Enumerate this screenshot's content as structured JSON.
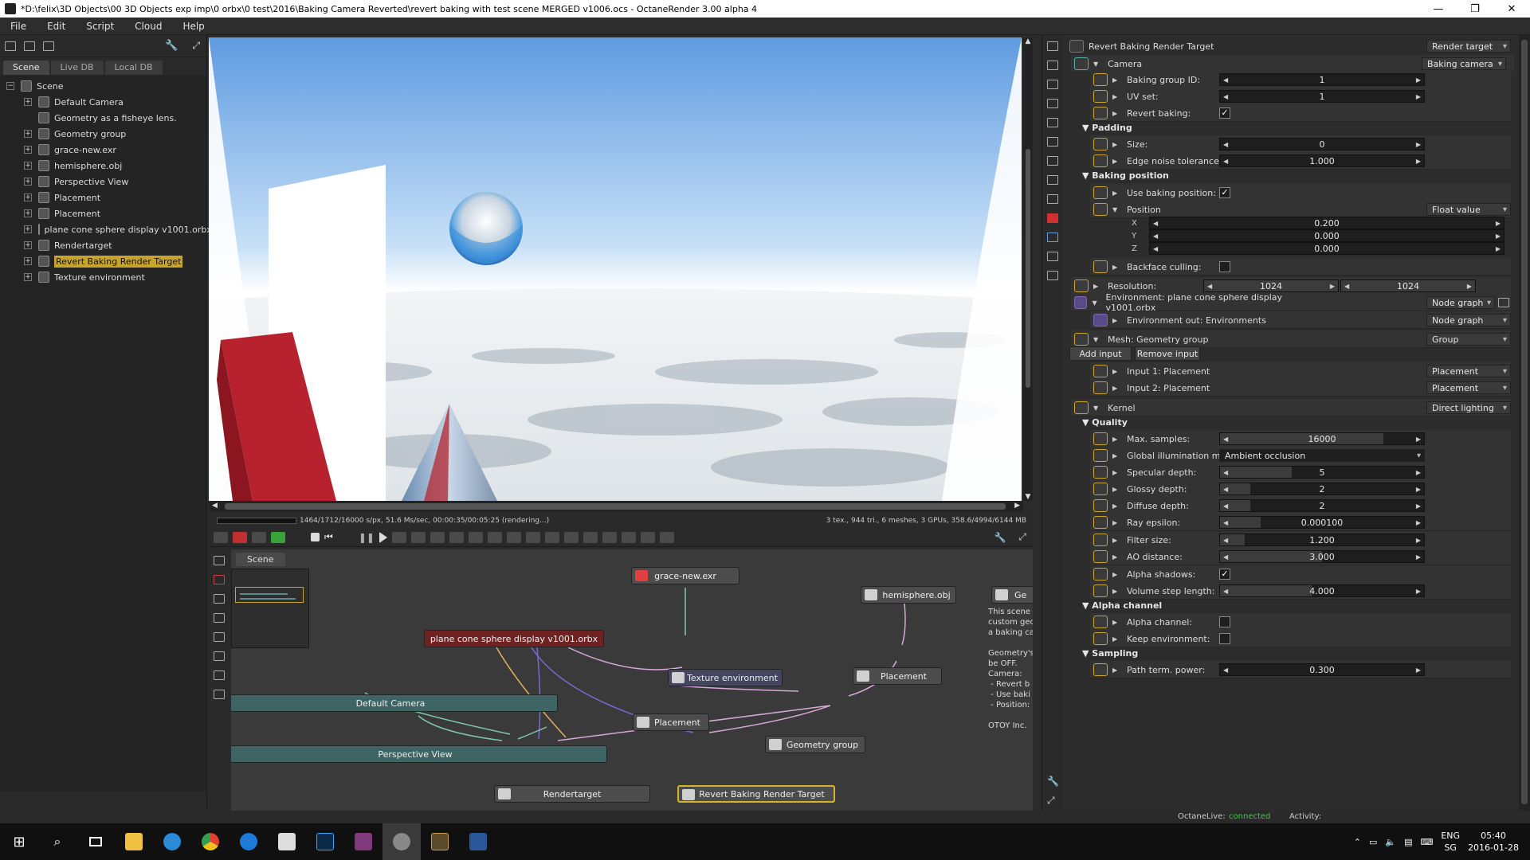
{
  "window": {
    "title": "*D:\\felix\\3D Objects\\00 3D Objects exp imp\\0 orbx\\0 test\\2016\\Baking Camera Reverted\\revert baking with test scene MERGED v1006.ocs - OctaneRender 3.00 alpha 4"
  },
  "menu": [
    "File",
    "Edit",
    "Script",
    "Cloud",
    "Help"
  ],
  "left": {
    "tabs": [
      "Scene",
      "Live DB",
      "Local DB"
    ],
    "root": "Scene",
    "items": [
      {
        "label": "Default Camera",
        "icon": "camera-icon"
      },
      {
        "label": "Geometry as a fisheye lens.",
        "icon": "comment-icon"
      },
      {
        "label": "Geometry group",
        "icon": "geometry-group-icon"
      },
      {
        "label": "grace-new.exr",
        "icon": "image-texture-icon"
      },
      {
        "label": "hemisphere.obj",
        "icon": "mesh-icon"
      },
      {
        "label": "Perspective View",
        "icon": "camera-icon"
      },
      {
        "label": "Placement",
        "icon": "placement-icon"
      },
      {
        "label": "Placement",
        "icon": "placement-icon"
      },
      {
        "label": "plane cone sphere display v1001.orbx",
        "icon": "orbx-icon"
      },
      {
        "label": "Rendertarget",
        "icon": "rendertarget-icon"
      },
      {
        "label": "Revert Baking Render Target",
        "icon": "rendertarget-icon",
        "selected": true
      },
      {
        "label": "Texture environment",
        "icon": "environment-icon"
      }
    ]
  },
  "render": {
    "status": "1464/1712/16000 s/px, 51.6 Ms/sec, 00:00:35/00:05:25 (rendering...)",
    "stats": "3 tex., 944 tri., 6 meshes, 3 GPUs, 358.6/4994/6144 MB"
  },
  "nodegraph": {
    "tab": "Scene",
    "nodes": {
      "grace": "grace-new.exr",
      "hemisphere": "hemisphere.obj",
      "orbx": "plane cone sphere display v1001.orbx",
      "texenv": "Texture environment",
      "default_camera": "Default Camera",
      "placement1": "Placement",
      "placement2": "Placement",
      "geometry_group": "Geometry group",
      "perspective_view": "Perspective View",
      "rendertarget": "Rendertarget",
      "revert_rt": "Revert Baking Render Target",
      "comment_title": "Ge"
    },
    "comment": [
      "This scene",
      "custom geo",
      "a baking ca",
      "",
      "Geometry's",
      "be OFF.",
      "Camera:",
      " - Revert b",
      " - Use baki",
      " - Position:",
      "",
      "OTOY Inc."
    ]
  },
  "props": {
    "header": "Revert Baking Render Target",
    "header_type": "Render target",
    "camera": {
      "label": "Camera",
      "type": "Baking camera"
    },
    "baking_group_id": {
      "label": "Baking group ID:",
      "value": "1"
    },
    "uv_set": {
      "label": "UV set:",
      "value": "1"
    },
    "revert_baking": {
      "label": "Revert baking:",
      "checked": "✓"
    },
    "padding_section": "Padding",
    "size": {
      "label": "Size:",
      "value": "0"
    },
    "edge_noise": {
      "label": "Edge noise tolerance:",
      "value": "1.000"
    },
    "baking_position_section": "Baking position",
    "use_baking_position": {
      "label": "Use baking position:",
      "checked": "✓"
    },
    "position": {
      "label": "Position",
      "type": "Float value",
      "x": "0.200",
      "y": "0.000",
      "z": "0.000",
      "xl": "X",
      "yl": "Y",
      "zl": "Z"
    },
    "backface_culling": {
      "label": "Backface culling:"
    },
    "resolution": {
      "label": "Resolution:",
      "w": "1024",
      "h": "1024"
    },
    "environment": {
      "label": "Environment: plane cone sphere display v1001.orbx",
      "type": "Node graph"
    },
    "environment_out": {
      "label": "Environment out: Environments",
      "type": "Node graph"
    },
    "mesh": {
      "label": "Mesh: Geometry group",
      "type": "Group"
    },
    "add_input": "Add input",
    "remove_input": "Remove input",
    "input1": {
      "label": "Input 1: Placement",
      "type": "Placement"
    },
    "input2": {
      "label": "Input 2: Placement",
      "type": "Placement"
    },
    "kernel": {
      "label": "Kernel",
      "type": "Direct lighting"
    },
    "quality_section": "Quality",
    "max_samples": {
      "label": "Max. samples:",
      "value": "16000",
      "fill": 0.8
    },
    "gi_mode": {
      "label": "Global illumination mode:",
      "value": "Ambient occlusion"
    },
    "specular_depth": {
      "label": "Specular depth:",
      "value": "5"
    },
    "glossy_depth": {
      "label": "Glossy depth:",
      "value": "2"
    },
    "diffuse_depth": {
      "label": "Diffuse depth:",
      "value": "2"
    },
    "ray_epsilon": {
      "label": "Ray epsilon:",
      "value": "0.000100"
    },
    "filter_size": {
      "label": "Filter size:",
      "value": "1.200"
    },
    "ao_distance": {
      "label": "AO distance:",
      "value": "3.000"
    },
    "alpha_shadows": {
      "label": "Alpha shadows:",
      "checked": "✓"
    },
    "volume_step": {
      "label": "Volume step length:",
      "value": "4.000"
    },
    "alpha_channel_section": "Alpha channel",
    "alpha_channel": {
      "label": "Alpha channel:"
    },
    "keep_environment": {
      "label": "Keep environment:"
    },
    "sampling_section": "Sampling",
    "path_term": {
      "label": "Path term. power:",
      "value": "0.300"
    }
  },
  "statusbar": {
    "live_label": "OctaneLive:",
    "live_status": "connected",
    "activity": "Activity:"
  },
  "taskbar": {
    "lang": "ENG",
    "region": "SG",
    "time": "05:40",
    "date": "2016-01-28"
  }
}
